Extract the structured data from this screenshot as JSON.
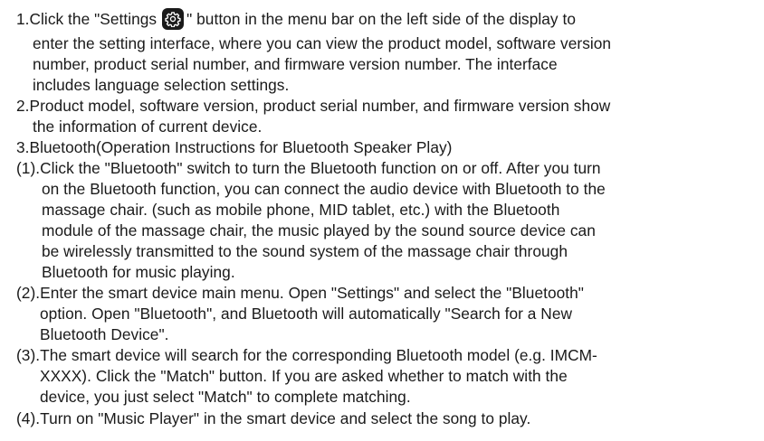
{
  "lines": [
    {
      "pre": "1.Click the \"Settings",
      "post": "\" button in the menu bar on the left side of the display to"
    },
    "enter the setting interface, where you can view the product model, software version",
    "number, product serial number, and firmware version number. The interface",
    "includes language selection settings.",
    "2.Product model, software version, product serial number, and firmware version show",
    "the information of current device.",
    "3.Bluetooth(Operation Instructions for Bluetooth Speaker Play)",
    "(1).Click the \"Bluetooth\" switch to turn the Bluetooth function on or off. After you turn",
    "on the Bluetooth function, you can connect the audio device with Bluetooth to the",
    "massage chair. (such as mobile phone, MID tablet, etc.) with the Bluetooth",
    "module of the massage chair, the music played by the sound source device can",
    "be wirelessly transmitted to the sound system of the massage chair through",
    "Bluetooth for music playing.",
    "(2).Enter the smart device main menu. Open \"Settings\" and select the \"Bluetooth\"",
    "option. Open \"Bluetooth\", and Bluetooth will automatically \"Search for a New",
    "Bluetooth Device\".",
    "(3).The smart device will search for the corresponding Bluetooth model (e.g. IMCM-",
    "XXXX). Click the \"Match\" button. If you are asked whether to match with the",
    "device, you just select \"Match\" to complete matching.",
    "(4).Turn on \"Music Player\" in the smart device and select the song to play."
  ],
  "icons": {
    "settings": "gear-icon"
  }
}
